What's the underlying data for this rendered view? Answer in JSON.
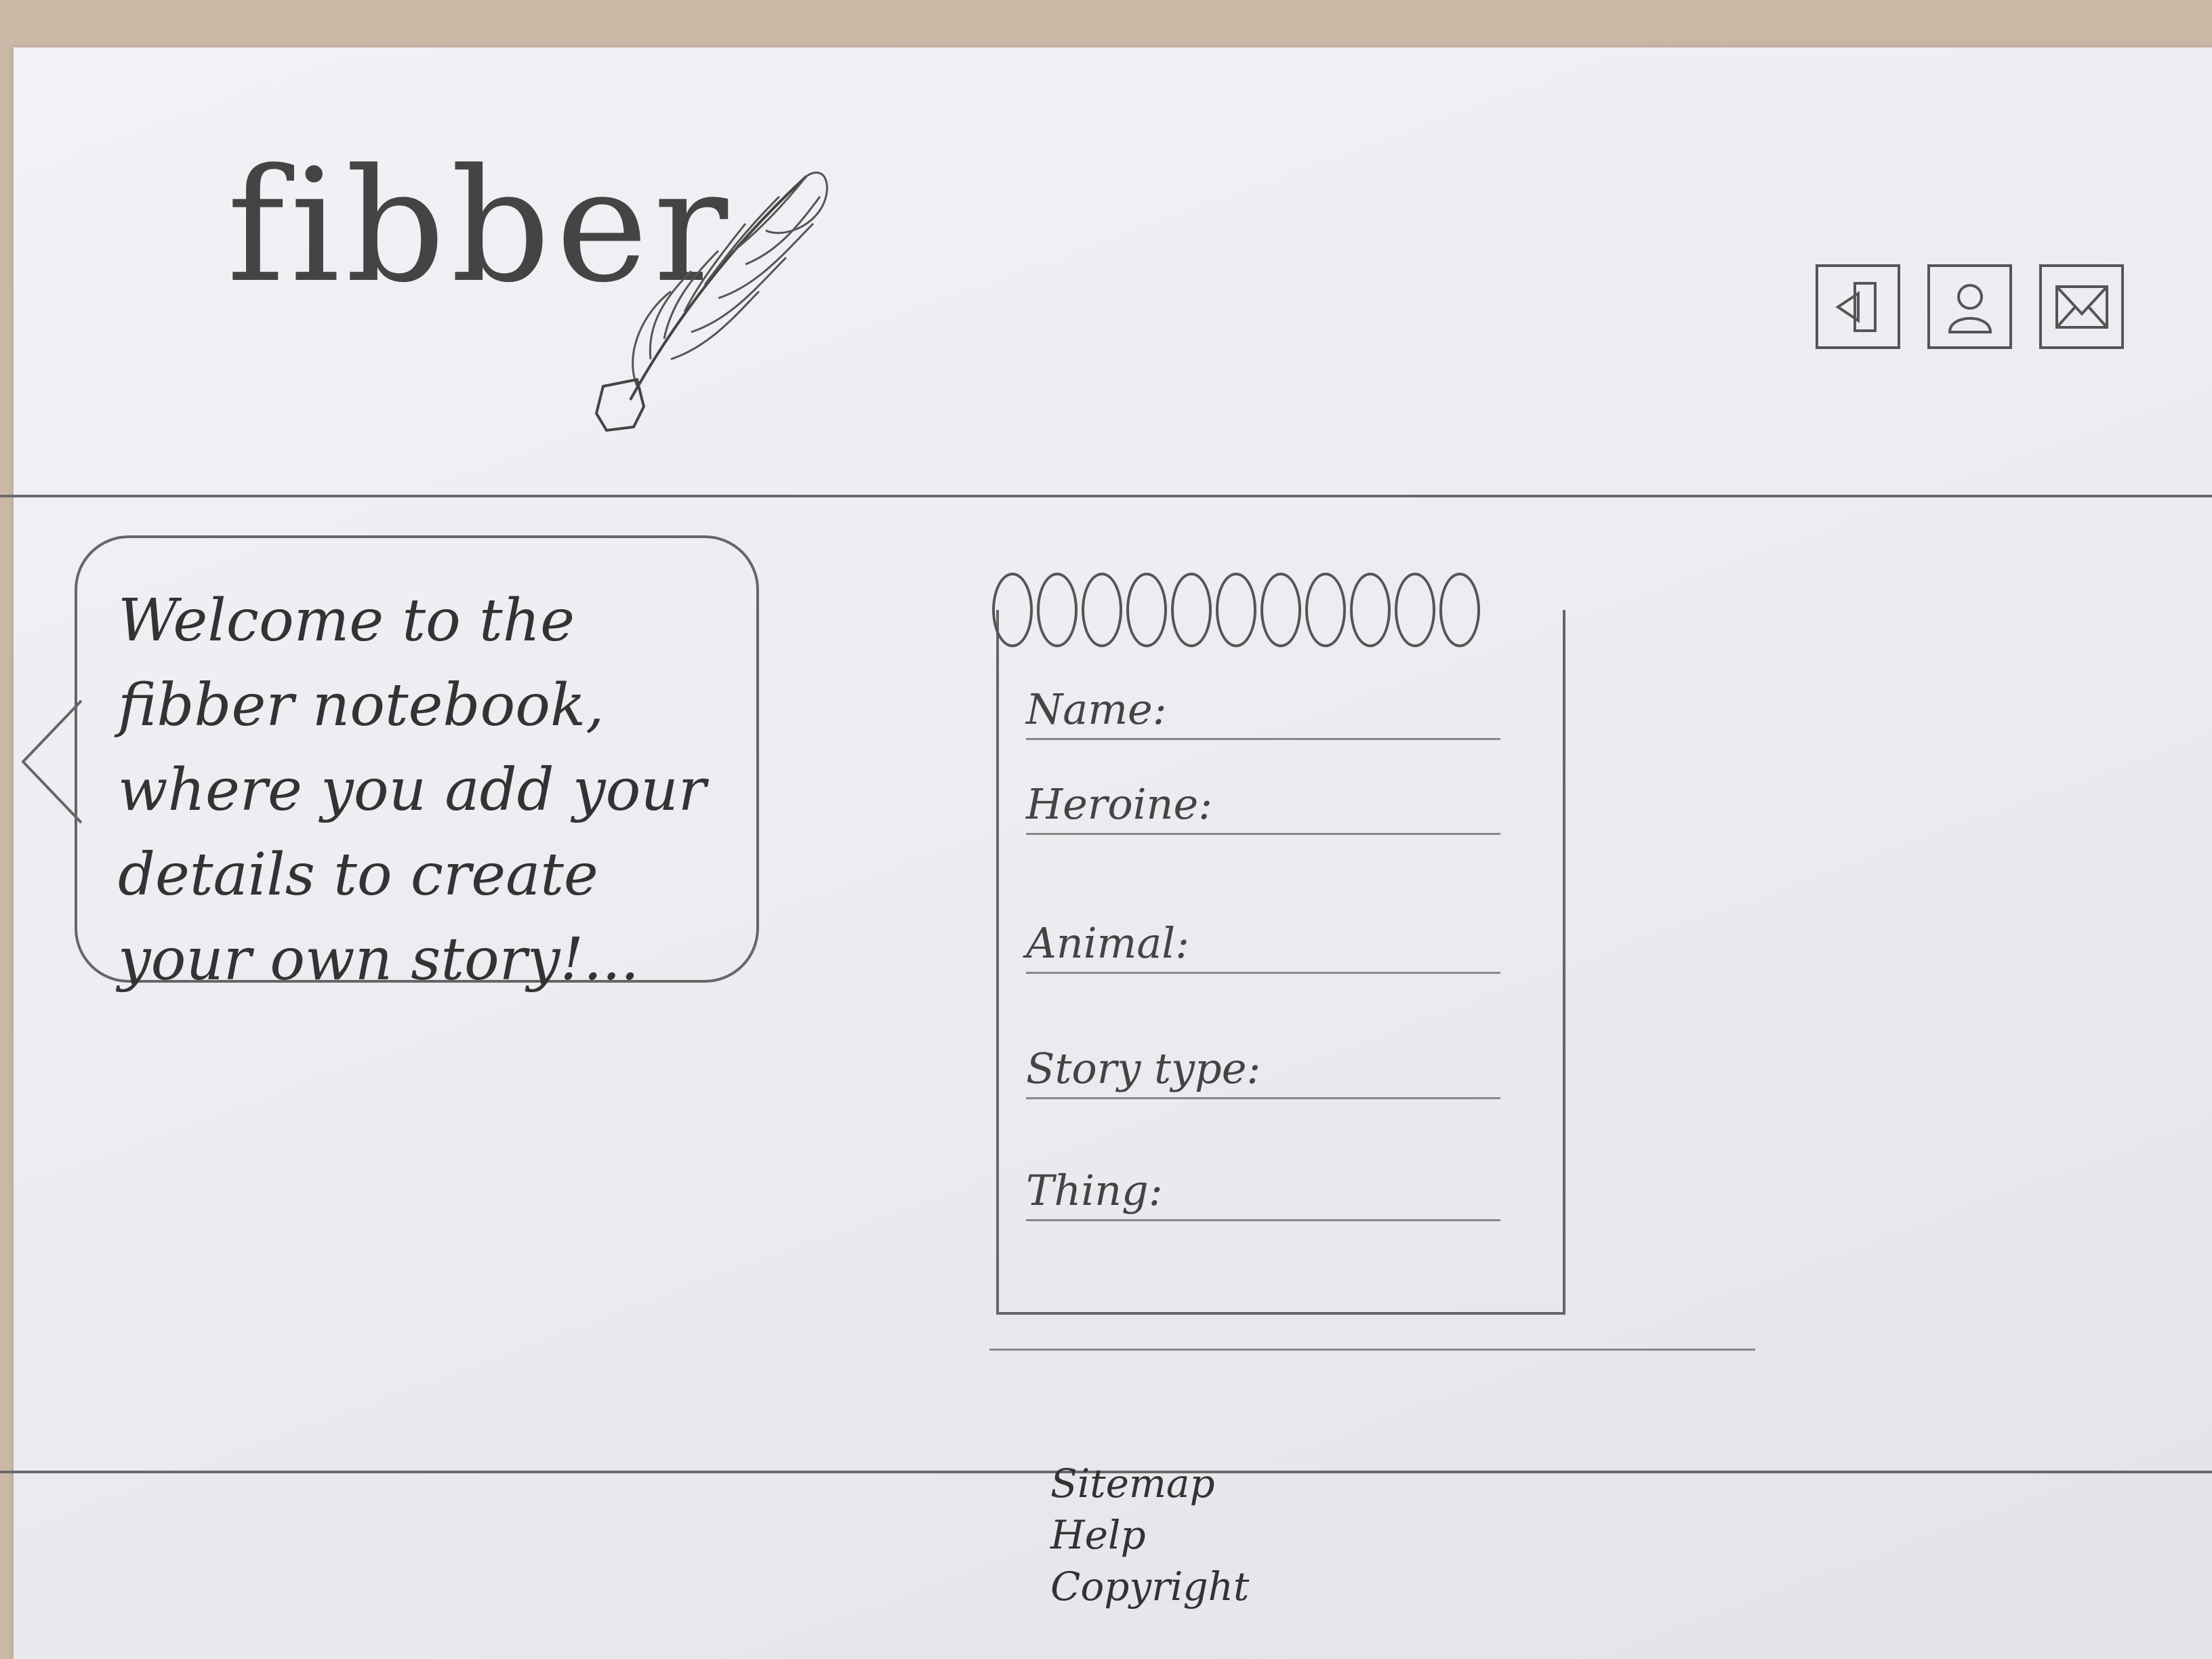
{
  "header": {
    "logo_text": "fibber",
    "logo_icon": "quill-icon",
    "nav_icons": [
      "logout-icon",
      "user-icon",
      "mail-icon"
    ]
  },
  "welcome": {
    "message": "Welcome to the fibber notebook, where you add your details to create your own story!..."
  },
  "notebook": {
    "fields": [
      {
        "label": "Name:"
      },
      {
        "label": "Heroine:"
      },
      {
        "label": "Animal:"
      },
      {
        "label": "Story type:"
      },
      {
        "label": "Thing:"
      }
    ]
  },
  "footer": {
    "links": [
      "Sitemap",
      "Help",
      "Copyright"
    ]
  }
}
